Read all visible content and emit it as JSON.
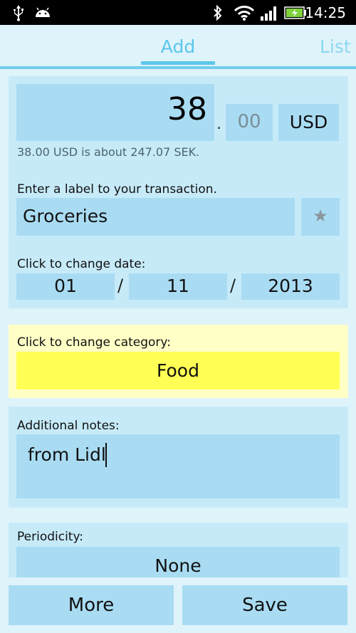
{
  "status_bar": {
    "time": "14:25"
  },
  "tabs": {
    "add": "Add",
    "list": "List"
  },
  "amount": {
    "whole": "38",
    "cents": "00",
    "currency": "USD",
    "conversion": "38.00 USD is about 247.07 SEK."
  },
  "transaction_label": {
    "prompt": "Enter a label to your transaction.",
    "value": "Groceries"
  },
  "date": {
    "prompt": "Click to change date:",
    "day": "01",
    "month": "11",
    "year": "2013",
    "separator": "/"
  },
  "category": {
    "prompt": "Click to change category:",
    "value": "Food"
  },
  "notes": {
    "prompt": "Additional notes:",
    "value": "from Lidl"
  },
  "periodicity": {
    "prompt": "Periodicity:",
    "value": "None"
  },
  "actions": {
    "more": "More",
    "save": "Save"
  },
  "colors": {
    "accent": "#5cc7ea",
    "background": "#dff3fb",
    "card": "#c6eaf8",
    "field": "#a9dcf3",
    "category_card": "#ffffc6",
    "category_button": "#ffff55"
  }
}
